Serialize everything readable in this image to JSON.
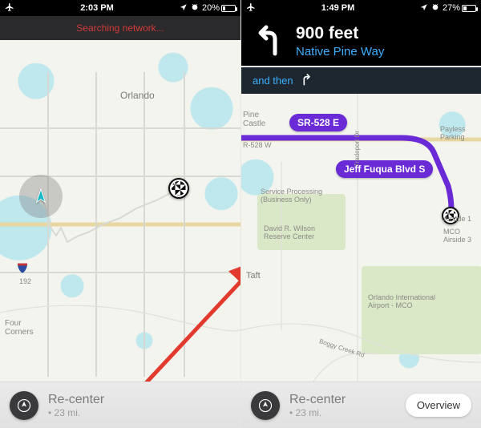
{
  "left": {
    "status": {
      "time": "2:03 PM",
      "battery_pct": "20%",
      "battery_fill_pct": 20
    },
    "banner": {
      "text": "Searching network..."
    },
    "map": {
      "labels": {
        "orlando": "Orlando",
        "four_corners": "Four\nCorners",
        "route_192": "192"
      }
    },
    "bottombar": {
      "recenter": "Re-center",
      "distance": "• 23 mi."
    }
  },
  "right": {
    "status": {
      "time": "1:49 PM",
      "battery_pct": "27%",
      "battery_fill_pct": 27
    },
    "directions": {
      "distance": "900 feet",
      "street": "Native Pine Way",
      "and_then": "and then"
    },
    "map": {
      "labels": {
        "pine_castle": "Pine\nCastle",
        "sr528w": "R-528 W",
        "payless": "Payless\nParking",
        "service_processing": "Service Processing\n(Business Only)",
        "david_wilson": "David R. Wilson\nReserve Center",
        "taft": "Taft",
        "tradeport": "Tradeport Dr",
        "oia": "Orlando International\nAirport - MCO",
        "airside1": "Airside 1",
        "airside3": "MCO\nAirside 3",
        "boggy": "Boggy Creek Rd"
      },
      "signs": {
        "sr528e": "SR-528 E",
        "jeff_fuqua": "Jeff Fuqua Blvd S"
      }
    },
    "bottombar": {
      "recenter": "Re-center",
      "distance": "• 23 mi.",
      "overview": "Overview"
    }
  }
}
